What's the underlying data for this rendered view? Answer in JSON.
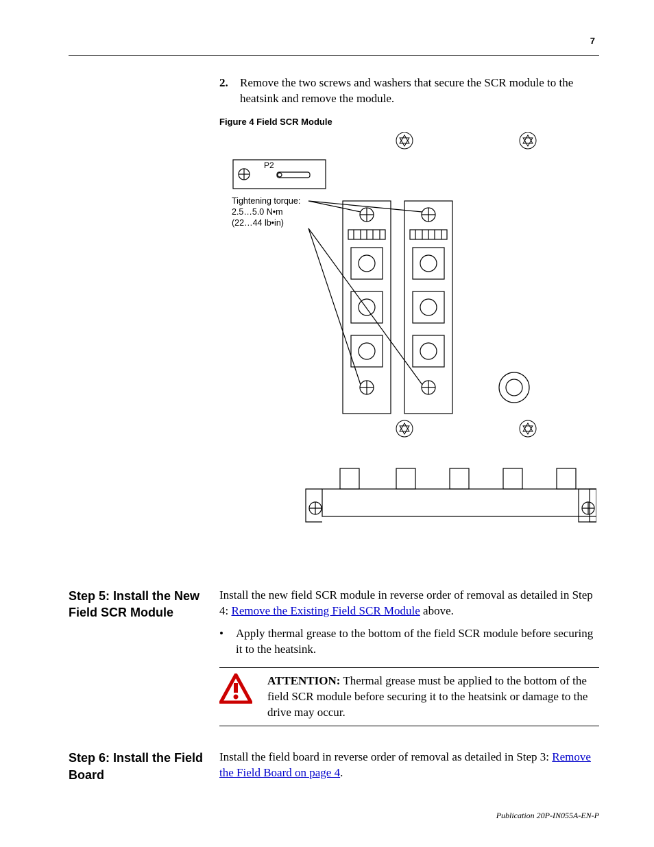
{
  "page_number": "7",
  "step2": {
    "number": "2.",
    "text": "Remove the two screws and washers that secure the SCR module to the heatsink and remove the module."
  },
  "figure4": {
    "caption": "Figure 4   Field SCR Module",
    "p2_label": "P2",
    "torque_note": "Tightening torque:\n2.5…5.0 N•m\n(22…44 lb•in)"
  },
  "step5": {
    "heading": "Step 5:   Install the New Field SCR Module",
    "para_before_link": "Install the new field SCR module in reverse order of removal as detailed in Step 4: ",
    "link": "Remove the Existing Field SCR Module",
    "para_after_link": " above.",
    "bullet": "Apply thermal grease to the bottom of the field SCR module before securing it to the heatsink.",
    "attention_label": "ATTENTION:",
    "attention_body": "  Thermal grease must be applied to the bottom of the field SCR module before securing it to the heatsink or damage to the drive may occur."
  },
  "step6": {
    "heading": "Step 6:   Install the Field Board",
    "para_before_link": "Install the field board in reverse order of removal as detailed in Step 3: ",
    "link": "Remove the Field Board on page 4",
    "para_after_link": "."
  },
  "publication": "Publication 20P-IN055A-EN-P"
}
